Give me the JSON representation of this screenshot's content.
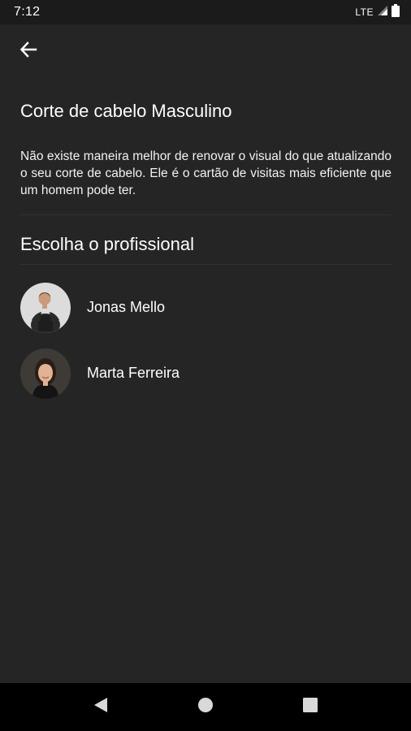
{
  "status_bar": {
    "time": "7:12",
    "network": "LTE"
  },
  "app_bar": {
    "back_icon": "arrow-back-icon"
  },
  "service": {
    "title": "Corte de cabelo Masculino",
    "description": "Não existe maneira melhor de renovar o visual do que atualizando o seu corte de cabelo. Ele é o cartão de visitas mais eficiente que um homem pode ter."
  },
  "professionals_section": {
    "title": "Escolha o profissional",
    "items": [
      {
        "name": "Jonas Mello"
      },
      {
        "name": "Marta Ferreira"
      }
    ]
  },
  "nav_bar": {
    "back_icon": "nav-back-icon",
    "home_icon": "nav-home-icon",
    "recents_icon": "nav-recents-icon"
  },
  "colors": {
    "background": "#262526",
    "status_bar": "#1b1b1b",
    "nav_bar": "#000000",
    "text": "#ffffff",
    "divider": "#343334"
  }
}
